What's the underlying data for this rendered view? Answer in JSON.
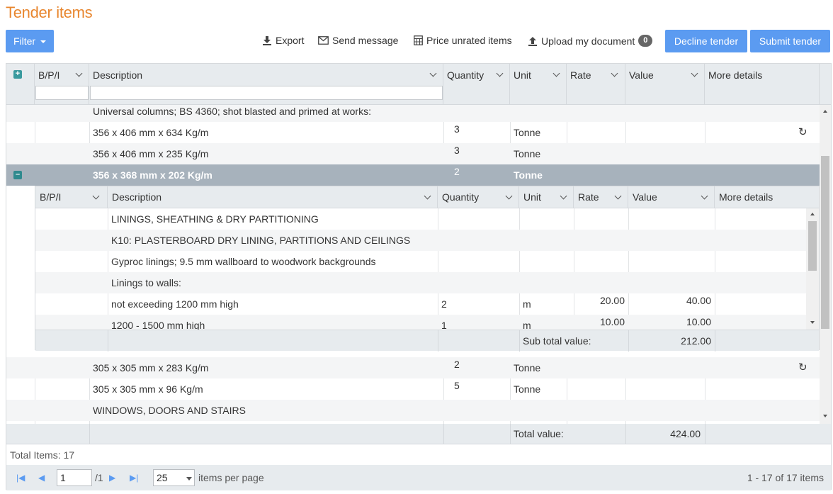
{
  "page": {
    "title": "Tender items"
  },
  "toolbar": {
    "filter_label": "Filter",
    "export_label": "Export",
    "send_message_label": "Send message",
    "price_unrated_label": "Price unrated items",
    "upload_label": "Upload my document",
    "upload_count": "0",
    "decline_label": "Decline tender",
    "submit_label": "Submit tender"
  },
  "grid": {
    "columns": [
      "B/P/I",
      "Description",
      "Quantity",
      "Unit",
      "Rate",
      "Value",
      "More details"
    ],
    "rows": [
      {
        "bpi": "",
        "description": "Universal columns; BS 4360; shot blasted and primed at works:",
        "quantity": "",
        "unit": "",
        "rate": "",
        "value": "",
        "history": false
      },
      {
        "bpi": "",
        "description": "356 x 406 mm x 634 Kg/m",
        "quantity": "3",
        "unit": "Tonne",
        "rate": "",
        "value": "",
        "history": true
      },
      {
        "bpi": "",
        "description": "356 x 406 mm x 235 Kg/m",
        "quantity": "3",
        "unit": "Tonne",
        "rate": "",
        "value": "",
        "history": false
      },
      {
        "bpi": "",
        "description": "356 x 368 mm x 202 Kg/m",
        "quantity": "2",
        "unit": "Tonne",
        "rate": "",
        "value": "",
        "history": false,
        "selected": true
      },
      {
        "bpi": "",
        "description": "305 x 305 mm x 283 Kg/m",
        "quantity": "2",
        "unit": "Tonne",
        "rate": "",
        "value": "",
        "history": true
      },
      {
        "bpi": "",
        "description": "305 x 305 mm x 96 Kg/m",
        "quantity": "5",
        "unit": "Tonne",
        "rate": "",
        "value": "",
        "history": false
      },
      {
        "bpi": "",
        "description": "WINDOWS, DOORS AND STAIRS",
        "quantity": "",
        "unit": "",
        "rate": "",
        "value": "",
        "history": false
      }
    ],
    "total_label": "Total value:",
    "total_value": "424.00"
  },
  "detail": {
    "columns": [
      "B/P/I",
      "Description",
      "Quantity",
      "Unit",
      "Rate",
      "Value",
      "More details"
    ],
    "rows": [
      {
        "bpi": "",
        "description": "LININGS, SHEATHING & DRY PARTITIONING",
        "quantity": "",
        "unit": "",
        "rate": "",
        "value": ""
      },
      {
        "bpi": "",
        "description": "K10: PLASTERBOARD DRY LINING, PARTITIONS AND CEILINGS",
        "quantity": "",
        "unit": "",
        "rate": "",
        "value": ""
      },
      {
        "bpi": "",
        "description": "Gyproc linings; 9.5 mm wallboard to woodwork backgrounds",
        "quantity": "",
        "unit": "",
        "rate": "",
        "value": ""
      },
      {
        "bpi": "",
        "description": "Linings to walls:",
        "quantity": "",
        "unit": "",
        "rate": "",
        "value": ""
      },
      {
        "bpi": "",
        "description": "not exceeding 1200 mm high",
        "quantity": "2",
        "unit": "m",
        "rate": "20.00",
        "value": "40.00"
      },
      {
        "bpi": "",
        "description": "1200 - 1500 mm high",
        "quantity": "1",
        "unit": "m",
        "rate": "10.00",
        "value": "10.00"
      }
    ],
    "subtotal_label": "Sub total value:",
    "subtotal_value": "212.00"
  },
  "footer": {
    "total_items": "Total Items: 17"
  },
  "pager": {
    "page": "1",
    "of_pages": "/1",
    "page_size": "25",
    "items_per_page_label": "items per page",
    "range_label": "1 - 17 of 17 items"
  },
  "colors": {
    "title": "#e8862e",
    "accent": "#5b9bf1",
    "header_bg": "#e7ebee",
    "selected_row": "#a7b2bc"
  },
  "icons": [
    "caret-down-icon",
    "download-icon",
    "envelope-icon",
    "calculator-icon",
    "upload-icon",
    "expand-icon",
    "collapse-icon",
    "chevron-down-icon",
    "history-icon",
    "first-page-icon",
    "prev-page-icon",
    "next-page-icon",
    "last-page-icon"
  ]
}
